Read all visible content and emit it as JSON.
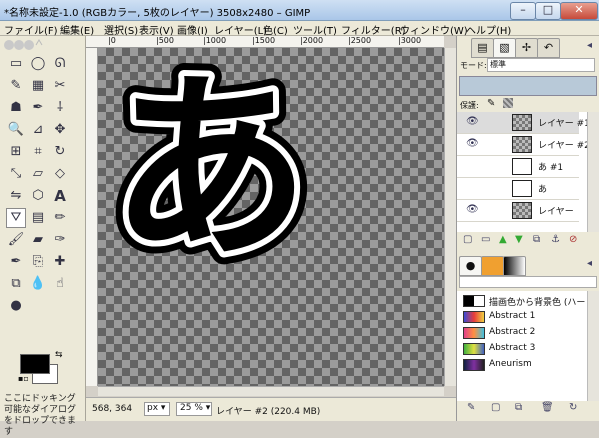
{
  "window": {
    "title": "*名称未設定-1.0 (RGBカラー, 5枚のレイヤー) 3508x2480 – GIMP",
    "minimize": "–",
    "maximize": "□",
    "close": "✕"
  },
  "menus": [
    "ファイル(F)",
    "編集(E)",
    "選択(S)",
    "表示(V)",
    "画像(I)",
    "レイヤー(L)",
    "色(C)",
    "ツール(T)",
    "フィルター(R)",
    "ウィンドウ(W)",
    "ヘルプ(H)"
  ],
  "toolbox": {
    "dock_hint": "ここにドッキング可能なダイアログをドロップできます"
  },
  "ruler": {
    "top_ticks": [
      "|0",
      "|500",
      "|1000",
      "|1500",
      "|2000",
      "|2500",
      "|3000"
    ]
  },
  "canvas": {
    "glyph": "あ"
  },
  "status": {
    "coords": "568, 364",
    "unit": "px",
    "zoom": "25 %",
    "layer_info": "レイヤー #2 (220.4 MB)"
  },
  "layers_panel": {
    "mode_label": "モード:",
    "mode_value": "標準",
    "lock_label": "保護:",
    "layers": [
      {
        "name": "レイヤー #1",
        "visible": true,
        "thumb": "checker"
      },
      {
        "name": "レイヤー #2",
        "visible": true,
        "thumb": "checker"
      },
      {
        "name": "あ #1",
        "visible": false,
        "thumb": "white"
      },
      {
        "name": "あ",
        "visible": false,
        "thumb": "white"
      },
      {
        "name": "レイヤー",
        "visible": true,
        "thumb": "checker"
      }
    ]
  },
  "gradients_panel": {
    "items": [
      {
        "name": "描画色から背景色 (ハードエッ",
        "colors": [
          "#000000",
          "#ffffff"
        ]
      },
      {
        "name": "Abstract 1",
        "colors": [
          "#3b4bd6",
          "#e83b3b",
          "#f0d040"
        ]
      },
      {
        "name": "Abstract 2",
        "colors": [
          "#e0408a",
          "#ff9040",
          "#40c0e0"
        ]
      },
      {
        "name": "Abstract 3",
        "colors": [
          "#40b040",
          "#e0e040",
          "#4060c0"
        ]
      },
      {
        "name": "Aneurism",
        "colors": [
          "#102040",
          "#8030a0",
          "#202020"
        ]
      }
    ]
  },
  "colors": {
    "foreground": "#000000",
    "background": "#ffffff"
  }
}
